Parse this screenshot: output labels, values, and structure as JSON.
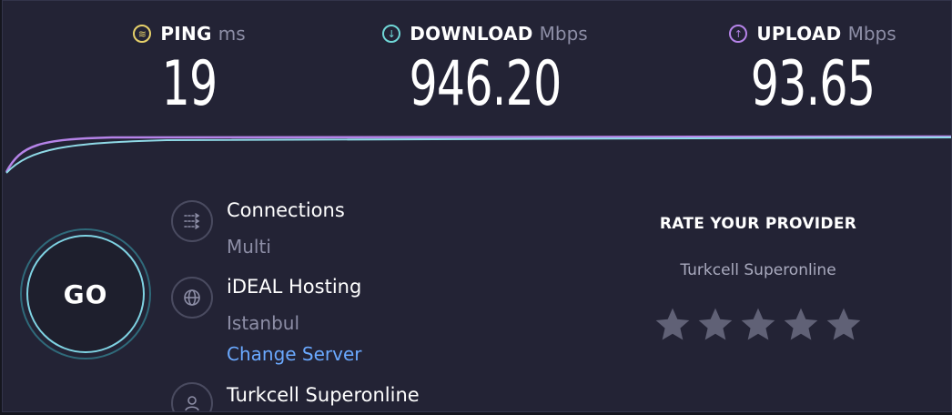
{
  "metrics": {
    "ping": {
      "label": "PING",
      "unit": "ms",
      "value": "19",
      "icon": "ping-icon",
      "color": "#e6d06a"
    },
    "download": {
      "label": "DOWNLOAD",
      "unit": "Mbps",
      "value": "946.20",
      "icon": "download-arrow-icon",
      "color": "#6fd6d6"
    },
    "upload": {
      "label": "UPLOAD",
      "unit": "Mbps",
      "value": "93.65",
      "icon": "upload-arrow-icon",
      "color": "#b583e8"
    }
  },
  "go_button": {
    "label": "GO"
  },
  "connections": {
    "title": "Connections",
    "value": "Multi",
    "icon": "connections-icon"
  },
  "server": {
    "title": "iDEAL Hosting",
    "location": "Istanbul",
    "change_link": "Change Server",
    "icon": "globe-icon"
  },
  "provider": {
    "title": "Turkcell Superonline",
    "icon": "user-icon"
  },
  "rate": {
    "title": "RATE YOUR PROVIDER",
    "isp": "Turkcell Superonline",
    "stars": 5,
    "rating": 0
  },
  "colors": {
    "background": "#232335",
    "accent": "#6fd6d6",
    "upload": "#b583e8",
    "link": "#6aa9ff"
  }
}
